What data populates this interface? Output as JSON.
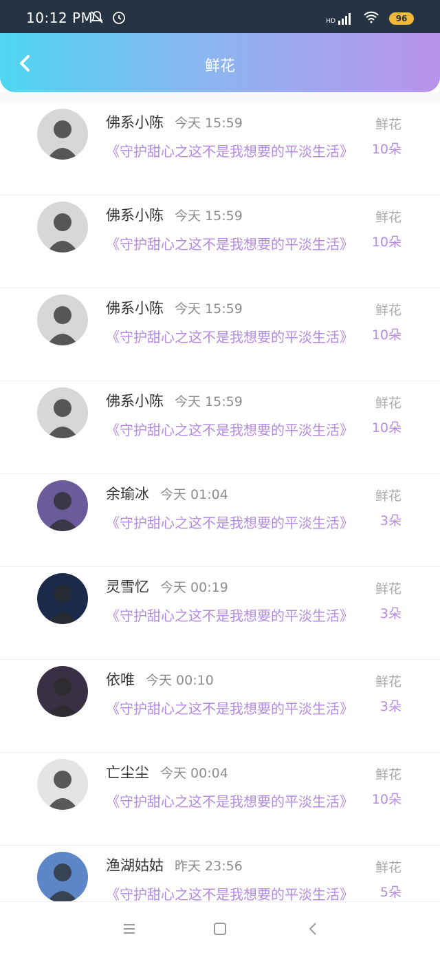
{
  "status_bar": {
    "time": "10:12 PM",
    "battery": "96",
    "network_label": "HD"
  },
  "header": {
    "title": "鲜花",
    "back_icon": "chevron-left-icon"
  },
  "items": [
    {
      "name": "佛系小陈",
      "time": "今天 15:59",
      "subtitle": "《守护甜心之这不是我想要的平淡生活》",
      "kind": "鲜花",
      "count": "10朵",
      "avatar_color": "#d9d6d6"
    },
    {
      "name": "佛系小陈",
      "time": "今天 15:59",
      "subtitle": "《守护甜心之这不是我想要的平淡生活》",
      "kind": "鲜花",
      "count": "10朵",
      "avatar_color": "#d9d6d6"
    },
    {
      "name": "佛系小陈",
      "time": "今天 15:59",
      "subtitle": "《守护甜心之这不是我想要的平淡生活》",
      "kind": "鲜花",
      "count": "10朵",
      "avatar_color": "#d9d6d6"
    },
    {
      "name": "佛系小陈",
      "time": "今天 15:59",
      "subtitle": "《守护甜心之这不是我想要的平淡生活》",
      "kind": "鲜花",
      "count": "10朵",
      "avatar_color": "#d9d6d6"
    },
    {
      "name": "余瑜冰",
      "time": "今天 01:04",
      "subtitle": "《守护甜心之这不是我想要的平淡生活》",
      "kind": "鲜花",
      "count": "3朵",
      "avatar_color": "#6a5c9a"
    },
    {
      "name": "灵雪忆",
      "time": "今天 00:19",
      "subtitle": "《守护甜心之这不是我想要的平淡生活》",
      "kind": "鲜花",
      "count": "3朵",
      "avatar_color": "#1b2a4a"
    },
    {
      "name": "依唯",
      "time": "今天 00:10",
      "subtitle": "《守护甜心之这不是我想要的平淡生活》",
      "kind": "鲜花",
      "count": "3朵",
      "avatar_color": "#3a3045"
    },
    {
      "name": "亡尘尘",
      "time": "今天 00:04",
      "subtitle": "《守护甜心之这不是我想要的平淡生活》",
      "kind": "鲜花",
      "count": "10朵",
      "avatar_color": "#e6e3e6"
    },
    {
      "name": "渔湖姑姑",
      "time": "昨天 23:56",
      "subtitle": "《守护甜心之这不是我想要的平淡生活》",
      "kind": "鲜花",
      "count": "5朵",
      "avatar_color": "#5c86c7"
    }
  ],
  "nav": {
    "menu_icon": "menu-icon",
    "home_icon": "square-icon",
    "back_icon": "back-triangle-icon"
  }
}
